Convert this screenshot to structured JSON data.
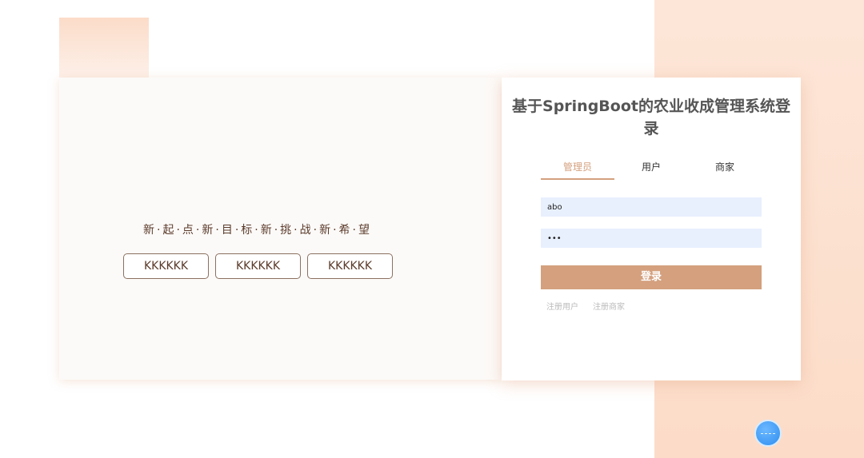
{
  "hero": {
    "slogan": "新·起·点·新·目·标·新·挑·战·新·希·望",
    "buttons": [
      "KKKKKK",
      "KKKKKK",
      "KKKKKK"
    ]
  },
  "login": {
    "title": "基于SpringBoot的农业收成管理系统登录",
    "tabs": [
      "管理员",
      "用户",
      "商家"
    ],
    "active_tab": "管理员",
    "username_value": "abo",
    "password_value": "•••",
    "submit_label": "登录",
    "links": [
      "注册用户",
      "注册商家"
    ]
  },
  "colors": {
    "accent": "#d4a07e",
    "background_peach": "#fcdcc8",
    "input_bg": "#e8f0fe"
  },
  "icons": {
    "floating_button": "assistant-bubble-icon"
  }
}
